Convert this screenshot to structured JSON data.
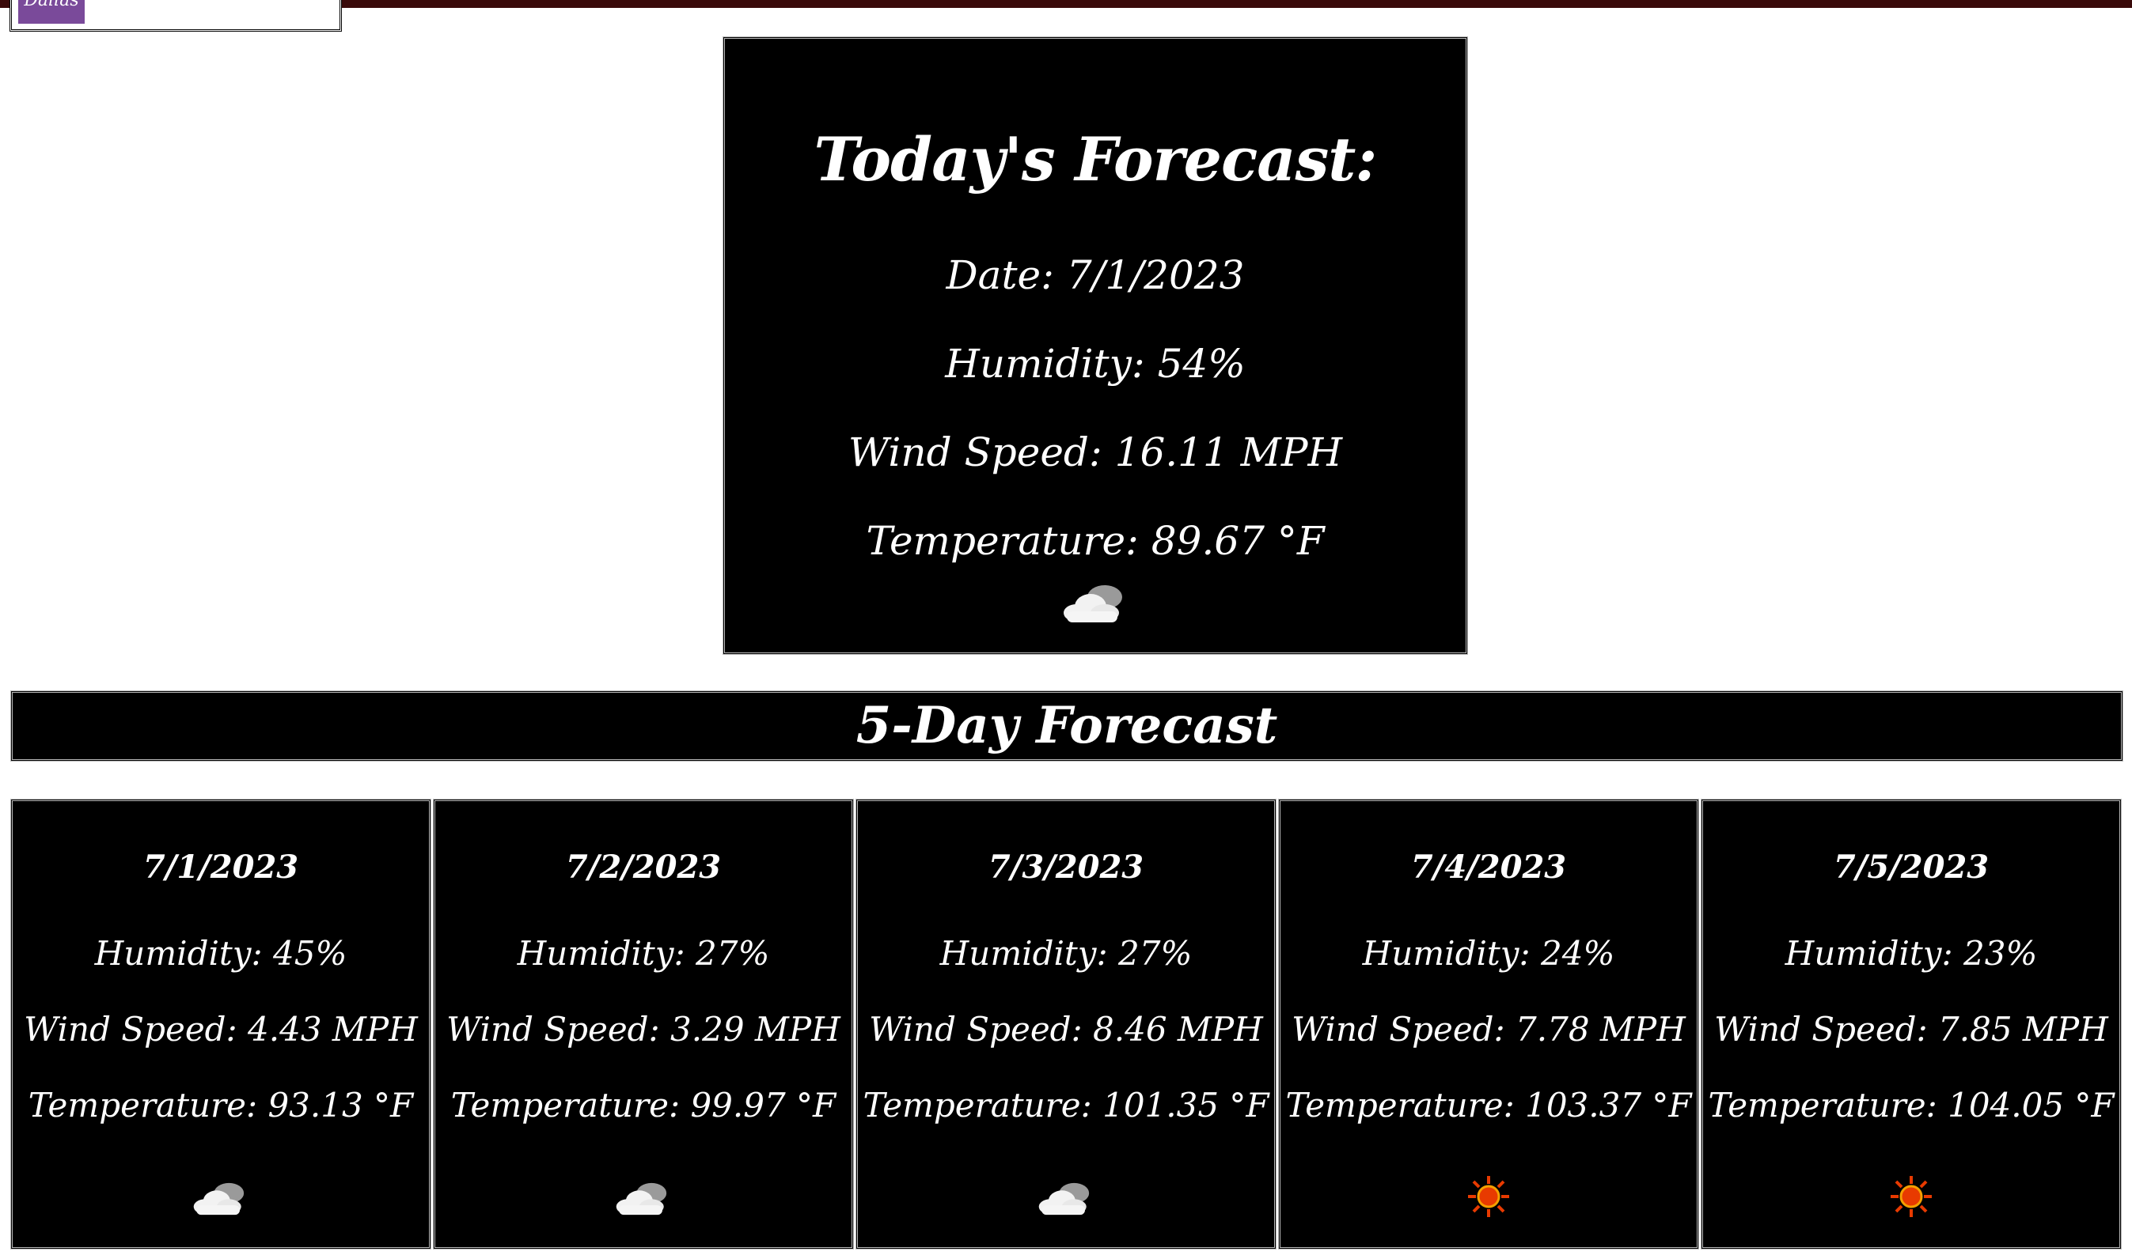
{
  "search": {
    "city_chip": "Dallas"
  },
  "today": {
    "title": "Today's Forecast:",
    "date": "Date: 7/1/2023",
    "humidity": "Humidity: 54%",
    "wind": "Wind Speed: 16.11 MPH",
    "temperature": "Temperature: 89.67 °F",
    "icon": "partly-cloudy-icon"
  },
  "five_day": {
    "title": "5-Day Forecast",
    "days": [
      {
        "date": "7/1/2023",
        "humidity": "Humidity: 45%",
        "wind": "Wind Speed: 4.43 MPH",
        "temperature": "Temperature: 93.13 °F",
        "icon": "partly-cloudy-icon"
      },
      {
        "date": "7/2/2023",
        "humidity": "Humidity: 27%",
        "wind": "Wind Speed: 3.29 MPH",
        "temperature": "Temperature: 99.97 °F",
        "icon": "partly-cloudy-icon"
      },
      {
        "date": "7/3/2023",
        "humidity": "Humidity: 27%",
        "wind": "Wind Speed: 8.46 MPH",
        "temperature": "Temperature: 101.35 °F",
        "icon": "partly-cloudy-icon"
      },
      {
        "date": "7/4/2023",
        "humidity": "Humidity: 24%",
        "wind": "Wind Speed: 7.78 MPH",
        "temperature": "Temperature: 103.37 °F",
        "icon": "sun-icon"
      },
      {
        "date": "7/5/2023",
        "humidity": "Humidity: 23%",
        "wind": "Wind Speed: 7.85 MPH",
        "temperature": "Temperature: 104.05 °F",
        "icon": "sun-icon"
      }
    ]
  },
  "colors": {
    "card_bg": "#000000",
    "card_text": "#ffffff",
    "chip_bg": "#7a4a9a",
    "sun_color": "#e83a00"
  }
}
